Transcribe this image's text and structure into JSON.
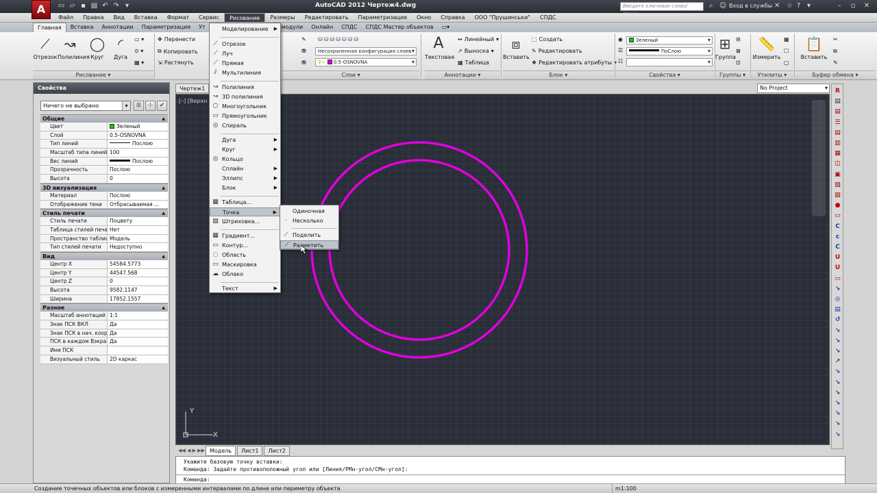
{
  "window": {
    "title": "AutoCAD 2012    Чертеж4.dwg",
    "search_placeholder": "Введите ключевое слово/фразу",
    "signin": "Вход в службы",
    "logo": "A"
  },
  "menubar": [
    "Файл",
    "Правка",
    "Вид",
    "Вставка",
    "Формат",
    "Сервис",
    "Рисование",
    "Размеры",
    "Редактировать",
    "Параметризация",
    "Окно",
    "Справка",
    "ООО \"Прушинськи\"",
    "СПДС"
  ],
  "ribbon_tabs": [
    "Главная",
    "Вставка",
    "Аннотации",
    "Параметризация",
    "Ут",
    "",
    "",
    "",
    "",
    "ключаемые модули",
    "Онлайн",
    "СПДС",
    "СПДС Мастер объектов"
  ],
  "ribbon": {
    "draw": {
      "line": "Отрезок",
      "polyline": "Полилиния",
      "circle": "Круг",
      "arc": "Дуга",
      "panel": "Рисование"
    },
    "modify": {
      "move": "Перенести",
      "copy": "Копировать",
      "stretch": "Растянуть"
    },
    "layers": {
      "state": "Несохраненная конфигурация слоев",
      "current": "0.5-OSNOVNA",
      "panel": "Слои"
    },
    "annot": {
      "text": "Текстовая",
      "linear": "Линейный",
      "leader": "Выноска",
      "table": "Таблица",
      "panel": "Аннотации"
    },
    "block": {
      "insert": "Вставить",
      "create": "Создать",
      "edit": "Редактировать",
      "editattr": "Редактировать атрибуты",
      "panel": "Блок"
    },
    "props": {
      "color": "Зеленый",
      "linetype": "ПоСлою",
      "panel": "Свойства"
    },
    "groups": {
      "group": "Группа",
      "panel": "Группы"
    },
    "utils": {
      "measure": "Измерить",
      "panel": "Утилиты"
    },
    "clip": {
      "paste": "Вставить",
      "panel": "Буфер обмена"
    }
  },
  "properties": {
    "title": "Свойства",
    "selection": "Ничего не выбрано",
    "sections": [
      {
        "name": "Общие",
        "rows": [
          [
            "Цвет",
            "Зеленый"
          ],
          [
            "Слой",
            "0.5-OSNOVNA"
          ],
          [
            "Тип линий",
            "Послою"
          ],
          [
            "Масштаб типа линий",
            "100"
          ],
          [
            "Вес линий",
            "Послою"
          ],
          [
            "Прозрачность",
            "Послою"
          ],
          [
            "Высота",
            "0"
          ]
        ]
      },
      {
        "name": "3D визуализация",
        "rows": [
          [
            "Материал",
            "Послою"
          ],
          [
            "Отображение тени",
            "Отбрасываемая ..."
          ]
        ]
      },
      {
        "name": "Стиль печати",
        "rows": [
          [
            "Стиль печати",
            "Поцвету"
          ],
          [
            "Таблица стилей печати",
            "Нет"
          ],
          [
            "Пространство таблицы ...",
            "Модель"
          ],
          [
            "Тип стилей печати",
            "Недоступно"
          ]
        ]
      },
      {
        "name": "Вид",
        "rows": [
          [
            "Центр X",
            "54584.5773"
          ],
          [
            "Центр Y",
            "44547.568"
          ],
          [
            "Центр Z",
            "0"
          ],
          [
            "Высота",
            "9582.1147"
          ],
          [
            "Ширина",
            "17852.1557"
          ]
        ]
      },
      {
        "name": "Разное",
        "rows": [
          [
            "Масштаб аннотаций",
            "1:1"
          ],
          [
            "Знак ПСК ВКЛ",
            "Да"
          ],
          [
            "Знак ПСК в нач. коорд.",
            "Да"
          ],
          [
            "ПСК в каждом Вэкране",
            "Да"
          ],
          [
            "Имя ПСК",
            ""
          ],
          [
            "Визуальный стиль",
            "2D каркас"
          ]
        ]
      }
    ]
  },
  "drawing": {
    "doc_tab": "Чертеж1",
    "doc_tab2": "Ч",
    "viewport_label": "[–] [Верхн",
    "project": "No Project",
    "circle_color": "#e000e0",
    "ucs_x": "X",
    "ucs_y": "Y"
  },
  "layout_tabs": [
    "Модель",
    "Лист1",
    "Лист2"
  ],
  "command": {
    "line1": "Укажите базовую точку вставки:",
    "line2": "Команда: Задайте противоположный угол или [Линия/РМн-угол/СМн-угол]:",
    "prompt": "Команда:"
  },
  "status": {
    "text": "Создание точечных объектов или блоков с измеренными интервалами по длине или периметру объекта",
    "scale": "m1:100"
  },
  "draw_menu": {
    "items": [
      {
        "label": "Моделирование",
        "arrow": true
      },
      {
        "label": "Отрезок"
      },
      {
        "label": "Луч"
      },
      {
        "label": "Прямая"
      },
      {
        "label": "Мультилиния"
      },
      {
        "label": "Полилиния"
      },
      {
        "label": "3D полилиния"
      },
      {
        "label": "Многоугольник"
      },
      {
        "label": "Прямоугольник"
      },
      {
        "label": "Спираль"
      },
      {
        "label": "Дуга",
        "arrow": true
      },
      {
        "label": "Круг",
        "arrow": true
      },
      {
        "label": "Кольцо"
      },
      {
        "label": "Сплайн",
        "arrow": true
      },
      {
        "label": "Эллипс",
        "arrow": true
      },
      {
        "label": "Блок",
        "arrow": true
      },
      {
        "label": "Таблица..."
      },
      {
        "label": "Точка",
        "arrow": true
      },
      {
        "label": "Штриховка..."
      },
      {
        "label": "Градиент..."
      },
      {
        "label": "Контур..."
      },
      {
        "label": "Область"
      },
      {
        "label": "Маскировка"
      },
      {
        "label": "Облако"
      },
      {
        "label": "Текст",
        "arrow": true
      }
    ]
  },
  "point_menu": {
    "items": [
      "Одиночная",
      "Несколько",
      "Поделить",
      "Разметить"
    ]
  }
}
